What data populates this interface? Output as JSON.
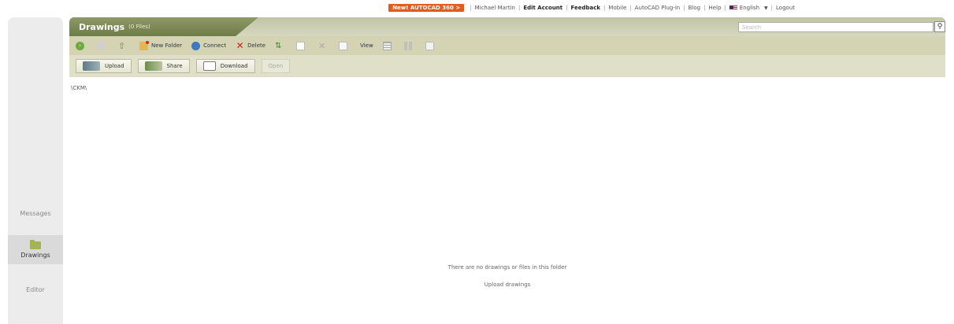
{
  "topbar": {
    "promo": "New! AUTOCAD 360  >",
    "user": "Michael Martin",
    "edit_account": "Edit Account",
    "feedback": "Feedback",
    "mobile": "Mobile",
    "plugin": "AutoCAD Plug-in",
    "blog": "Blog",
    "help": "Help",
    "language": "English",
    "logout": "Logout"
  },
  "nav": {
    "messages": "Messages",
    "drawings": "Drawings",
    "editor": "Editor"
  },
  "header": {
    "title": "Drawings",
    "count": "(0 Files)",
    "search_placeholder": "Search"
  },
  "toolbar": {
    "new_folder": "New Folder",
    "connect": "Connect",
    "delete": "Delete",
    "view": "View"
  },
  "actions": {
    "upload": "Upload",
    "share": "Share",
    "download": "Download",
    "open": "Open"
  },
  "path": "\\CKM\\",
  "empty": {
    "message": "There are no drawings or files in this folder",
    "link": "Upload drawings"
  },
  "colors": {
    "header_tab": "#7d8a55",
    "header_bar": "#c1c5a5",
    "promo": "#e25c1e",
    "delete": "#d21f1f"
  }
}
